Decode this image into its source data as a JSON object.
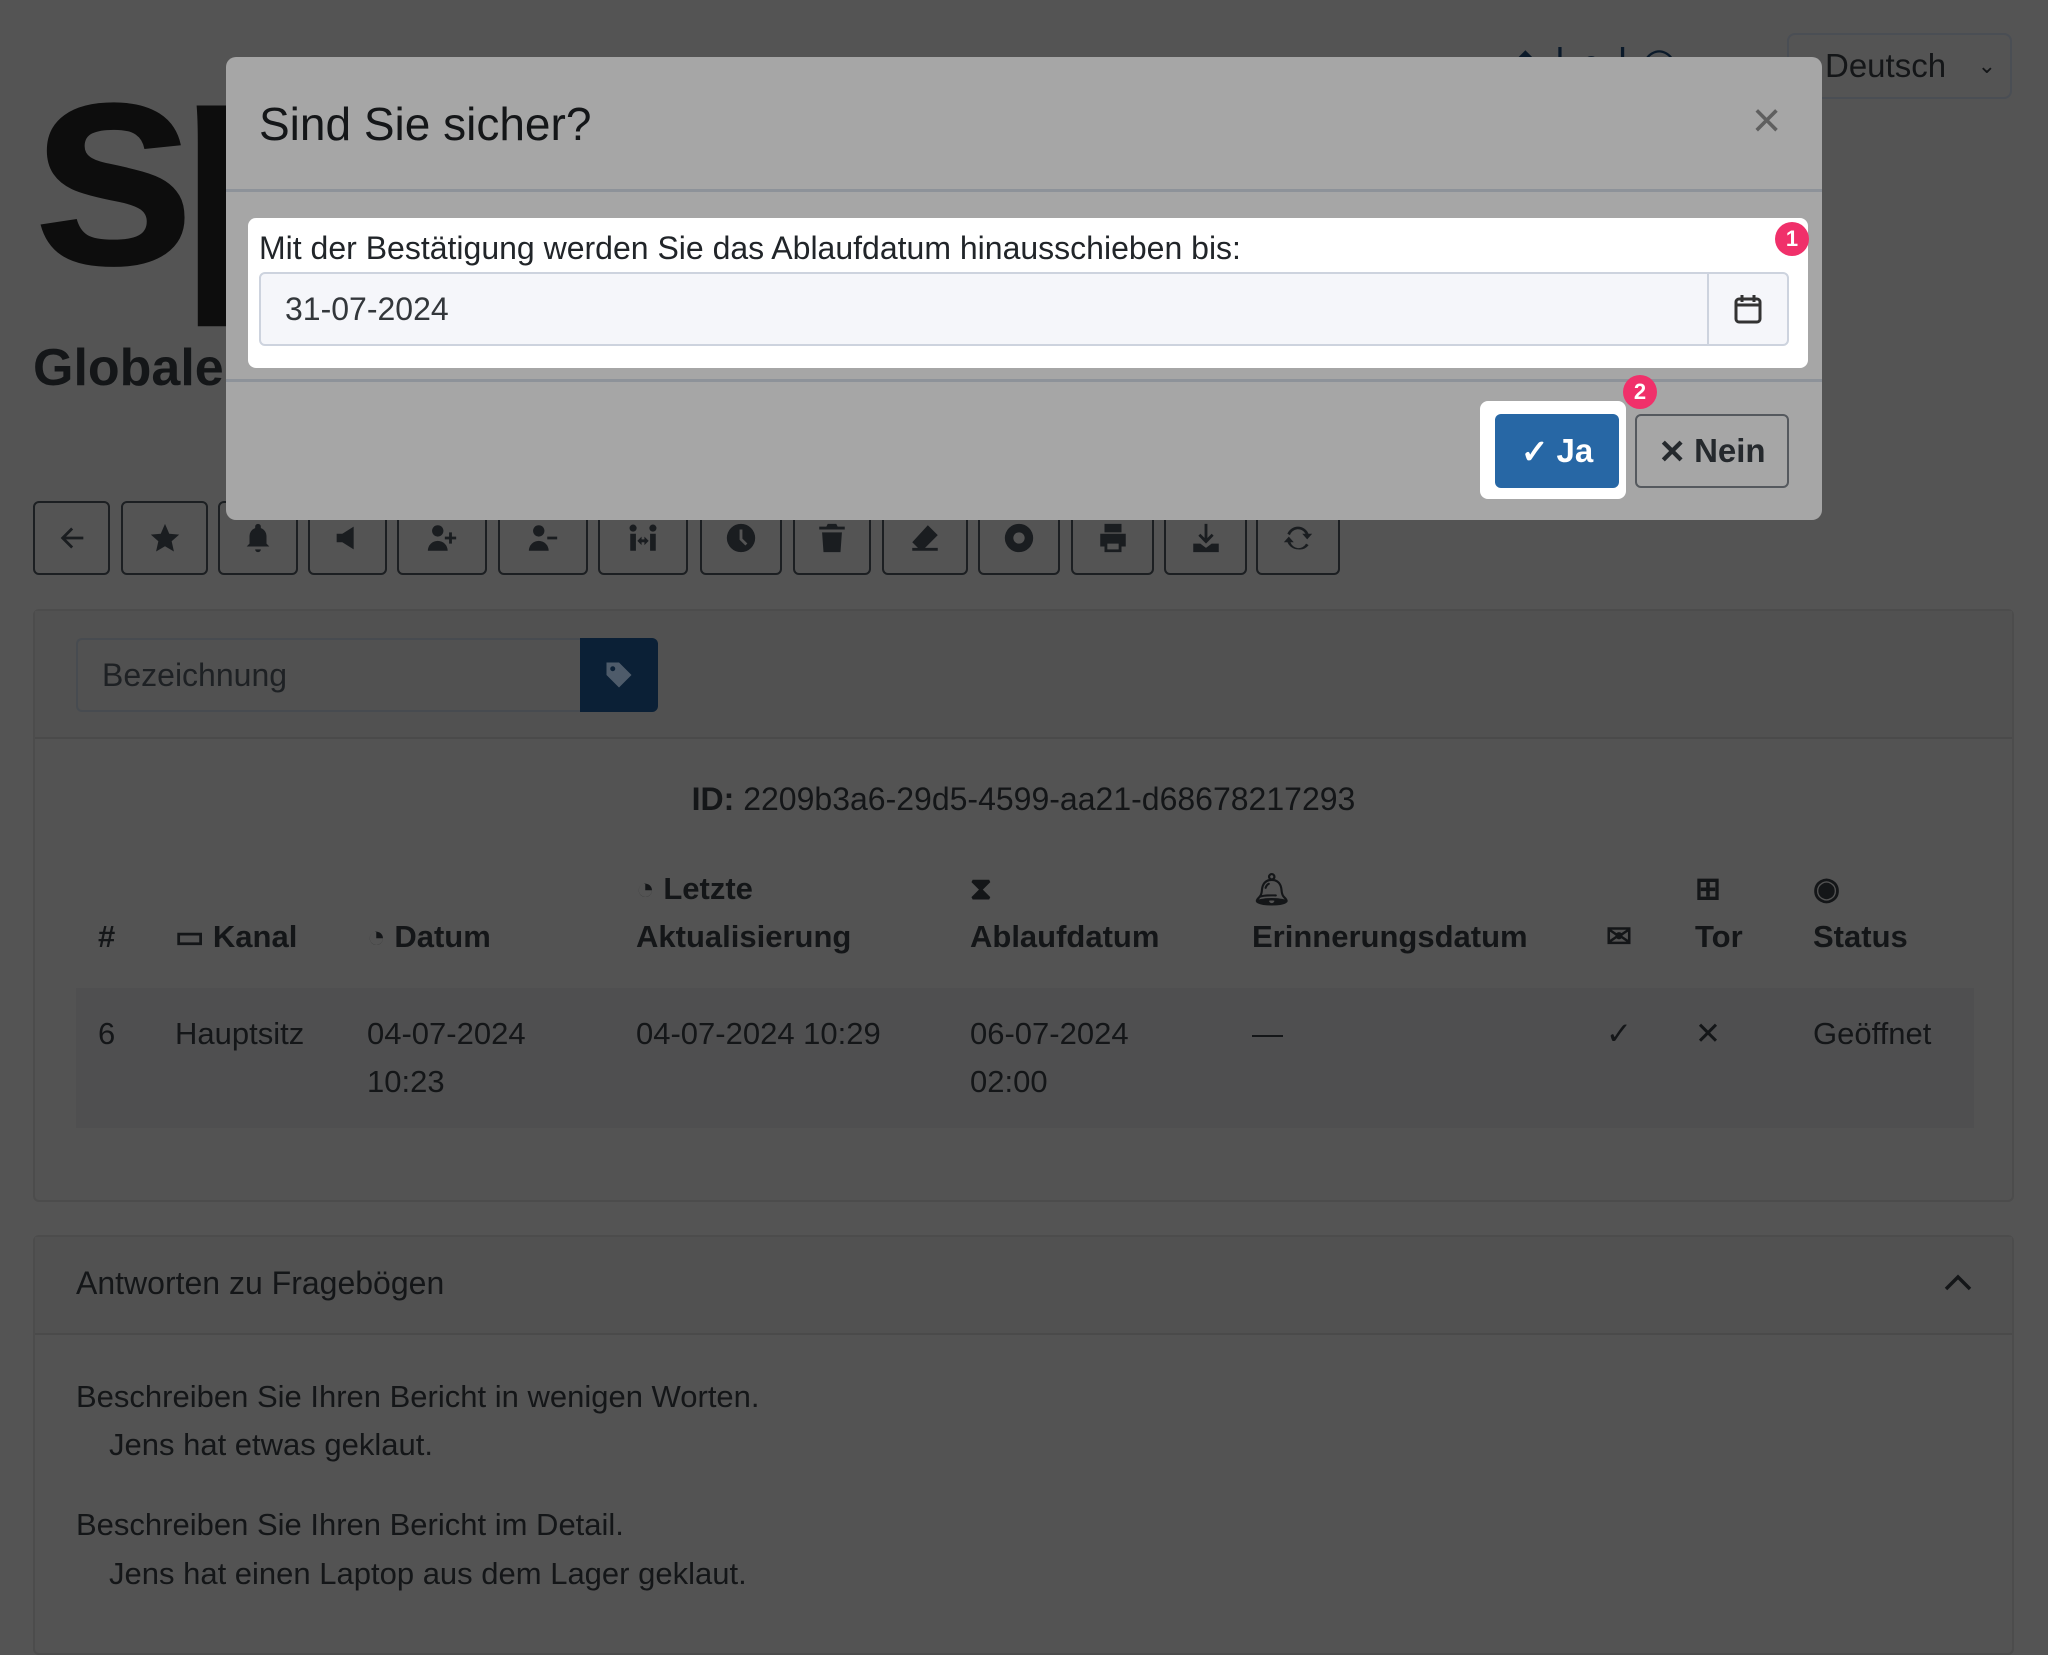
{
  "header": {
    "logo_text": "sp",
    "language": "Deutsch",
    "page_title": "Globale"
  },
  "toolbar": {
    "buttons": [
      {
        "icon": "arrow-left-icon"
      },
      {
        "icon": "star-icon"
      },
      {
        "icon": "bell-icon"
      },
      {
        "icon": "megaphone-icon"
      },
      {
        "icon": "user-plus-icon"
      },
      {
        "icon": "user-minus-icon"
      },
      {
        "icon": "people-arrows-icon"
      },
      {
        "icon": "clock-icon"
      },
      {
        "icon": "trash-icon"
      },
      {
        "icon": "eraser-icon"
      },
      {
        "icon": "circle-dot-icon"
      },
      {
        "icon": "print-icon"
      },
      {
        "icon": "download-icon"
      },
      {
        "icon": "refresh-icon"
      }
    ]
  },
  "label_input": {
    "placeholder": "Bezeichnung"
  },
  "report": {
    "id_label": "ID:",
    "id_value": "2209b3a6-29d5-4599-aa21-d68678217293",
    "columns": [
      "#",
      "Kanal",
      "Datum",
      "Letzte",
      "Aktualisierung",
      "Ablaufdatum",
      "Erinnerungsdatum",
      "Tor",
      "Status"
    ],
    "row": {
      "num": "6",
      "kanal": "Hauptsitz",
      "datum_1": "04-07-2024",
      "datum_2": "10:23",
      "letzte": "04-07-2024 10:29",
      "ablauf_1": "06-07-2024",
      "ablauf_2": "02:00",
      "erinnerung": "—",
      "mail": "✓",
      "tor": "✕",
      "status": "Geöffnet"
    }
  },
  "answers": {
    "title": "Antworten zu Fragebögen",
    "items": [
      {
        "q": "Beschreiben Sie Ihren Bericht in wenigen Worten.",
        "a": "Jens hat etwas geklaut."
      },
      {
        "q": "Beschreiben Sie Ihren Bericht im Detail.",
        "a": "Jens hat einen Laptop aus dem Lager geklaut."
      }
    ]
  },
  "modal": {
    "title": "Sind Sie sicher?",
    "close": "×",
    "label": "Mit der Bestätigung werden Sie das Ablaufdatum hinausschieben bis:",
    "date_value": "31-07-2024",
    "yes": "Ja",
    "no": "Nein",
    "yes_icon": "✓",
    "no_icon": "✕",
    "badge_1": "1",
    "badge_2": "2"
  },
  "colors": {
    "primary": "#2767a5",
    "badge": "#f0306a",
    "tag_button": "#0b2036"
  }
}
